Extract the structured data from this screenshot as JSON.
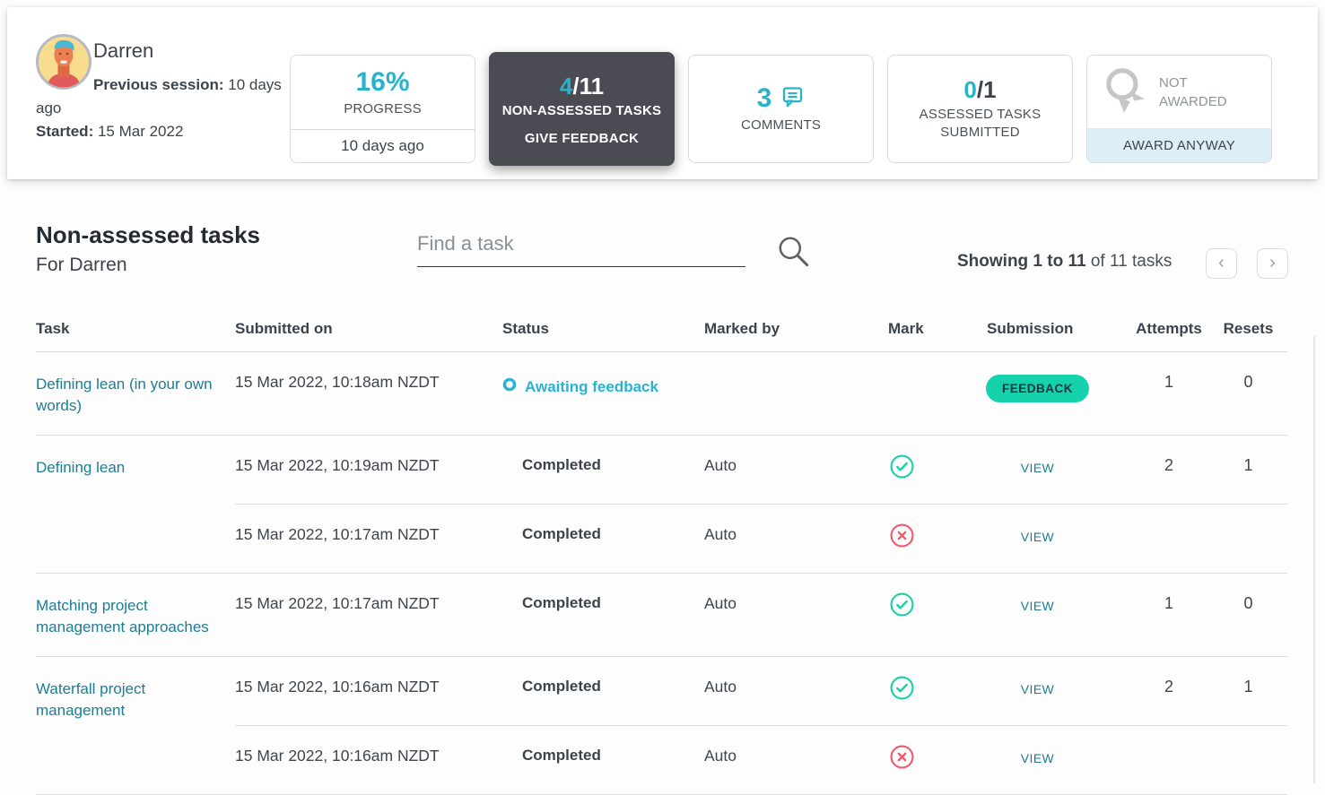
{
  "student": {
    "name": "Darren",
    "previous_session_label": "Previous session:",
    "previous_session_value": "10 days ago",
    "started_label": "Started:",
    "started_value": "15 Mar 2022"
  },
  "stats": {
    "progress": {
      "value": "16%",
      "label": "PROGRESS",
      "footer": "10 days ago"
    },
    "non_assessed": {
      "value_highlight": "4",
      "value_rest": "/11",
      "label": "NON-ASSESSED TASKS",
      "action": "GIVE FEEDBACK"
    },
    "comments": {
      "value": "3",
      "label": "COMMENTS"
    },
    "assessed": {
      "value_highlight": "0",
      "value_rest": "/1",
      "label": "ASSESSED TASKS SUBMITTED"
    },
    "award": {
      "status": "NOT AWARDED",
      "action": "AWARD ANYWAY"
    }
  },
  "main": {
    "title": "Non-assessed tasks",
    "subtitle": "For Darren",
    "search_placeholder": "Find a task",
    "showing_bold": "Showing 1 to 11",
    "showing_rest": " of 11 tasks"
  },
  "pagination": {
    "prev": "‹",
    "next": "›"
  },
  "table": {
    "headers": {
      "task": "Task",
      "submitted": "Submitted on",
      "status": "Status",
      "marked_by": "Marked by",
      "mark": "Mark",
      "submission": "Submission",
      "attempts": "Attempts",
      "resets": "Resets"
    },
    "groups": [
      {
        "task": "Defining lean (in your own words)",
        "attempts": "1",
        "resets": "0",
        "submissions": [
          {
            "submitted": "15 Mar 2022, 10:18am NZDT",
            "status": "Awaiting feedback",
            "marked_by": "",
            "mark": "none",
            "action": "FEEDBACK"
          }
        ]
      },
      {
        "task": "Defining lean",
        "attempts": "2",
        "resets": "1",
        "submissions": [
          {
            "submitted": "15 Mar 2022, 10:19am NZDT",
            "status": "Completed",
            "marked_by": "Auto",
            "mark": "pass",
            "action": "VIEW"
          },
          {
            "submitted": "15 Mar 2022, 10:17am NZDT",
            "status": "Completed",
            "marked_by": "Auto",
            "mark": "fail",
            "action": "VIEW"
          }
        ]
      },
      {
        "task": "Matching project management approaches",
        "attempts": "1",
        "resets": "0",
        "submissions": [
          {
            "submitted": "15 Mar 2022, 10:17am NZDT",
            "status": "Completed",
            "marked_by": "Auto",
            "mark": "pass",
            "action": "VIEW"
          }
        ]
      },
      {
        "task": "Waterfall project management",
        "attempts": "2",
        "resets": "1",
        "submissions": [
          {
            "submitted": "15 Mar 2022, 10:16am NZDT",
            "status": "Completed",
            "marked_by": "Auto",
            "mark": "pass",
            "action": "VIEW"
          },
          {
            "submitted": "15 Mar 2022, 10:16am NZDT",
            "status": "Completed",
            "marked_by": "Auto",
            "mark": "fail",
            "action": "VIEW"
          }
        ]
      }
    ]
  },
  "colors": {
    "accent_cyan": "#29b2cc",
    "link_teal": "#1c7d95",
    "success_green": "#16d0a5",
    "error_red": "#f2566b",
    "dark_card": "#4a4b53",
    "feedback_button": "#15d2ad",
    "award_band": "#ddeef6"
  }
}
